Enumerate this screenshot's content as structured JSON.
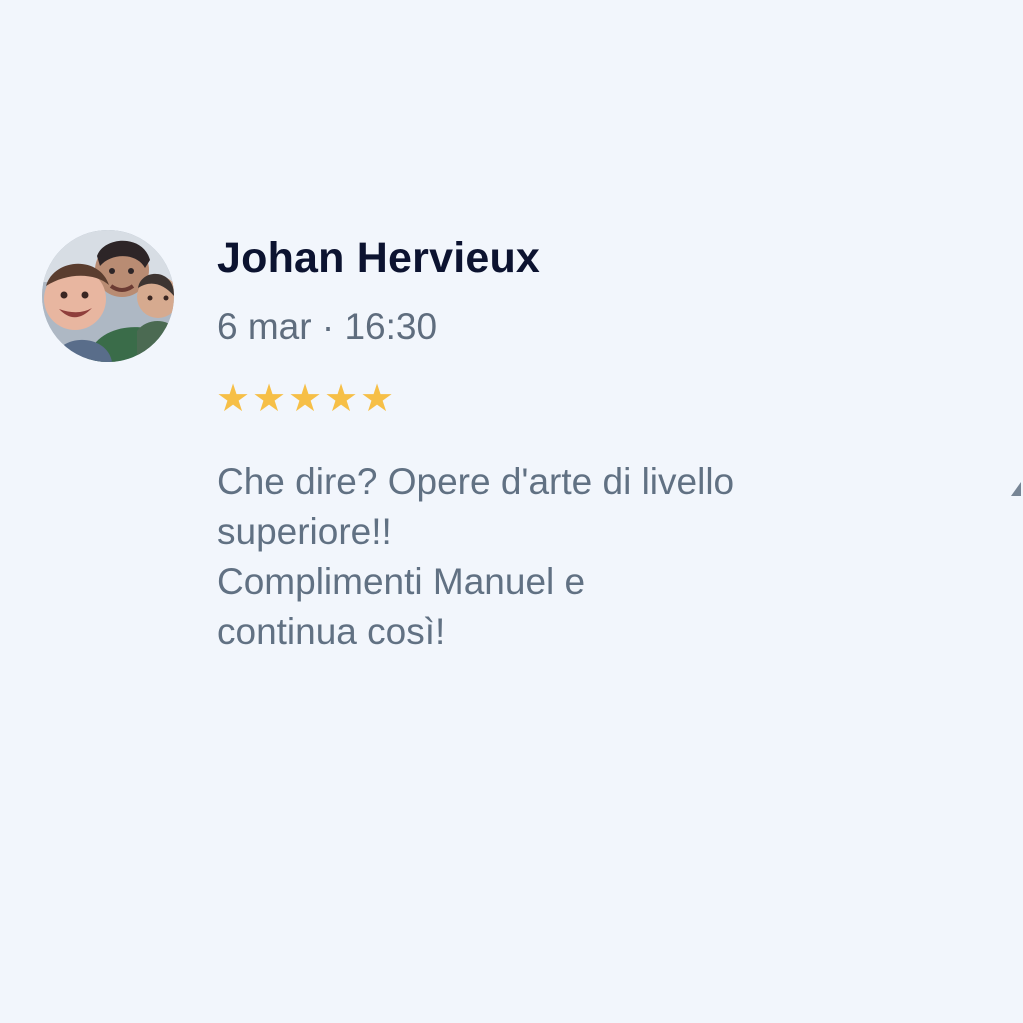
{
  "review": {
    "reviewer_name": "Johan Hervieux",
    "date": "6 mar · 16:30",
    "rating": 5,
    "rating_max": 5,
    "star_color": "#f6bf47",
    "text_lines": [
      "Che dire? Opere d'arte di livello",
      "superiore!!",
      "Complimenti Manuel e",
      "continua così!"
    ]
  },
  "icons": {
    "avatar": "user-photo",
    "star": "star-icon",
    "edge_mark": "partial-triangle-icon"
  },
  "colors": {
    "background": "#f2f6fc",
    "name_text": "#0c1330",
    "secondary_text": "#617183"
  }
}
